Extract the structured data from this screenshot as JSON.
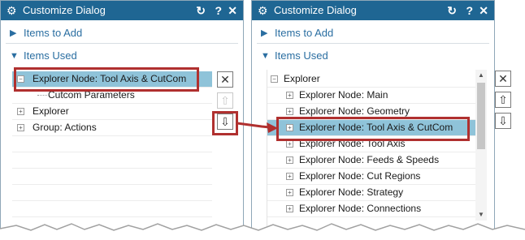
{
  "left_panel": {
    "title": "Customize Dialog",
    "title_buttons": [
      "↻",
      "?",
      "✕"
    ],
    "sections": {
      "add": "Items to Add",
      "used": "Items Used"
    },
    "tree": [
      {
        "label": "Explorer Node: Tool Axis & CutCom",
        "expander": "−",
        "selected": true
      },
      {
        "label": "Cutcom Parameters",
        "expander": ""
      },
      {
        "label": "Explorer",
        "expander": "+"
      },
      {
        "label": "Group: Actions",
        "expander": "+"
      }
    ],
    "side_buttons": [
      "✕",
      "⇧",
      "⇩"
    ]
  },
  "right_panel": {
    "title": "Customize Dialog",
    "title_buttons": [
      "↻",
      "?",
      "✕"
    ],
    "sections": {
      "add": "Items to Add",
      "used": "Items Used"
    },
    "tree": [
      {
        "label": "Explorer",
        "expander": "−"
      },
      {
        "label": "Explorer Node: Main",
        "expander": "+"
      },
      {
        "label": "Explorer Node: Geometry",
        "expander": "+"
      },
      {
        "label": "Explorer Node: Tool Axis & CutCom",
        "expander": "+",
        "selected": true
      },
      {
        "label": "Explorer Node: Tool Axis",
        "expander": "+"
      },
      {
        "label": "Explorer Node: Feeds & Speeds",
        "expander": "+"
      },
      {
        "label": "Explorer Node: Cut Regions",
        "expander": "+"
      },
      {
        "label": "Explorer Node: Strategy",
        "expander": "+"
      },
      {
        "label": "Explorer Node: Connections",
        "expander": "+"
      }
    ],
    "side_buttons": [
      "✕",
      "⇧",
      "⇩"
    ],
    "scroll_arrows": [
      "▲",
      "▼"
    ]
  },
  "colors": {
    "titlebar": "#1f6693",
    "section_text": "#2a6ea1",
    "selection": "#8fc3d9",
    "callout": "#b0302f"
  }
}
